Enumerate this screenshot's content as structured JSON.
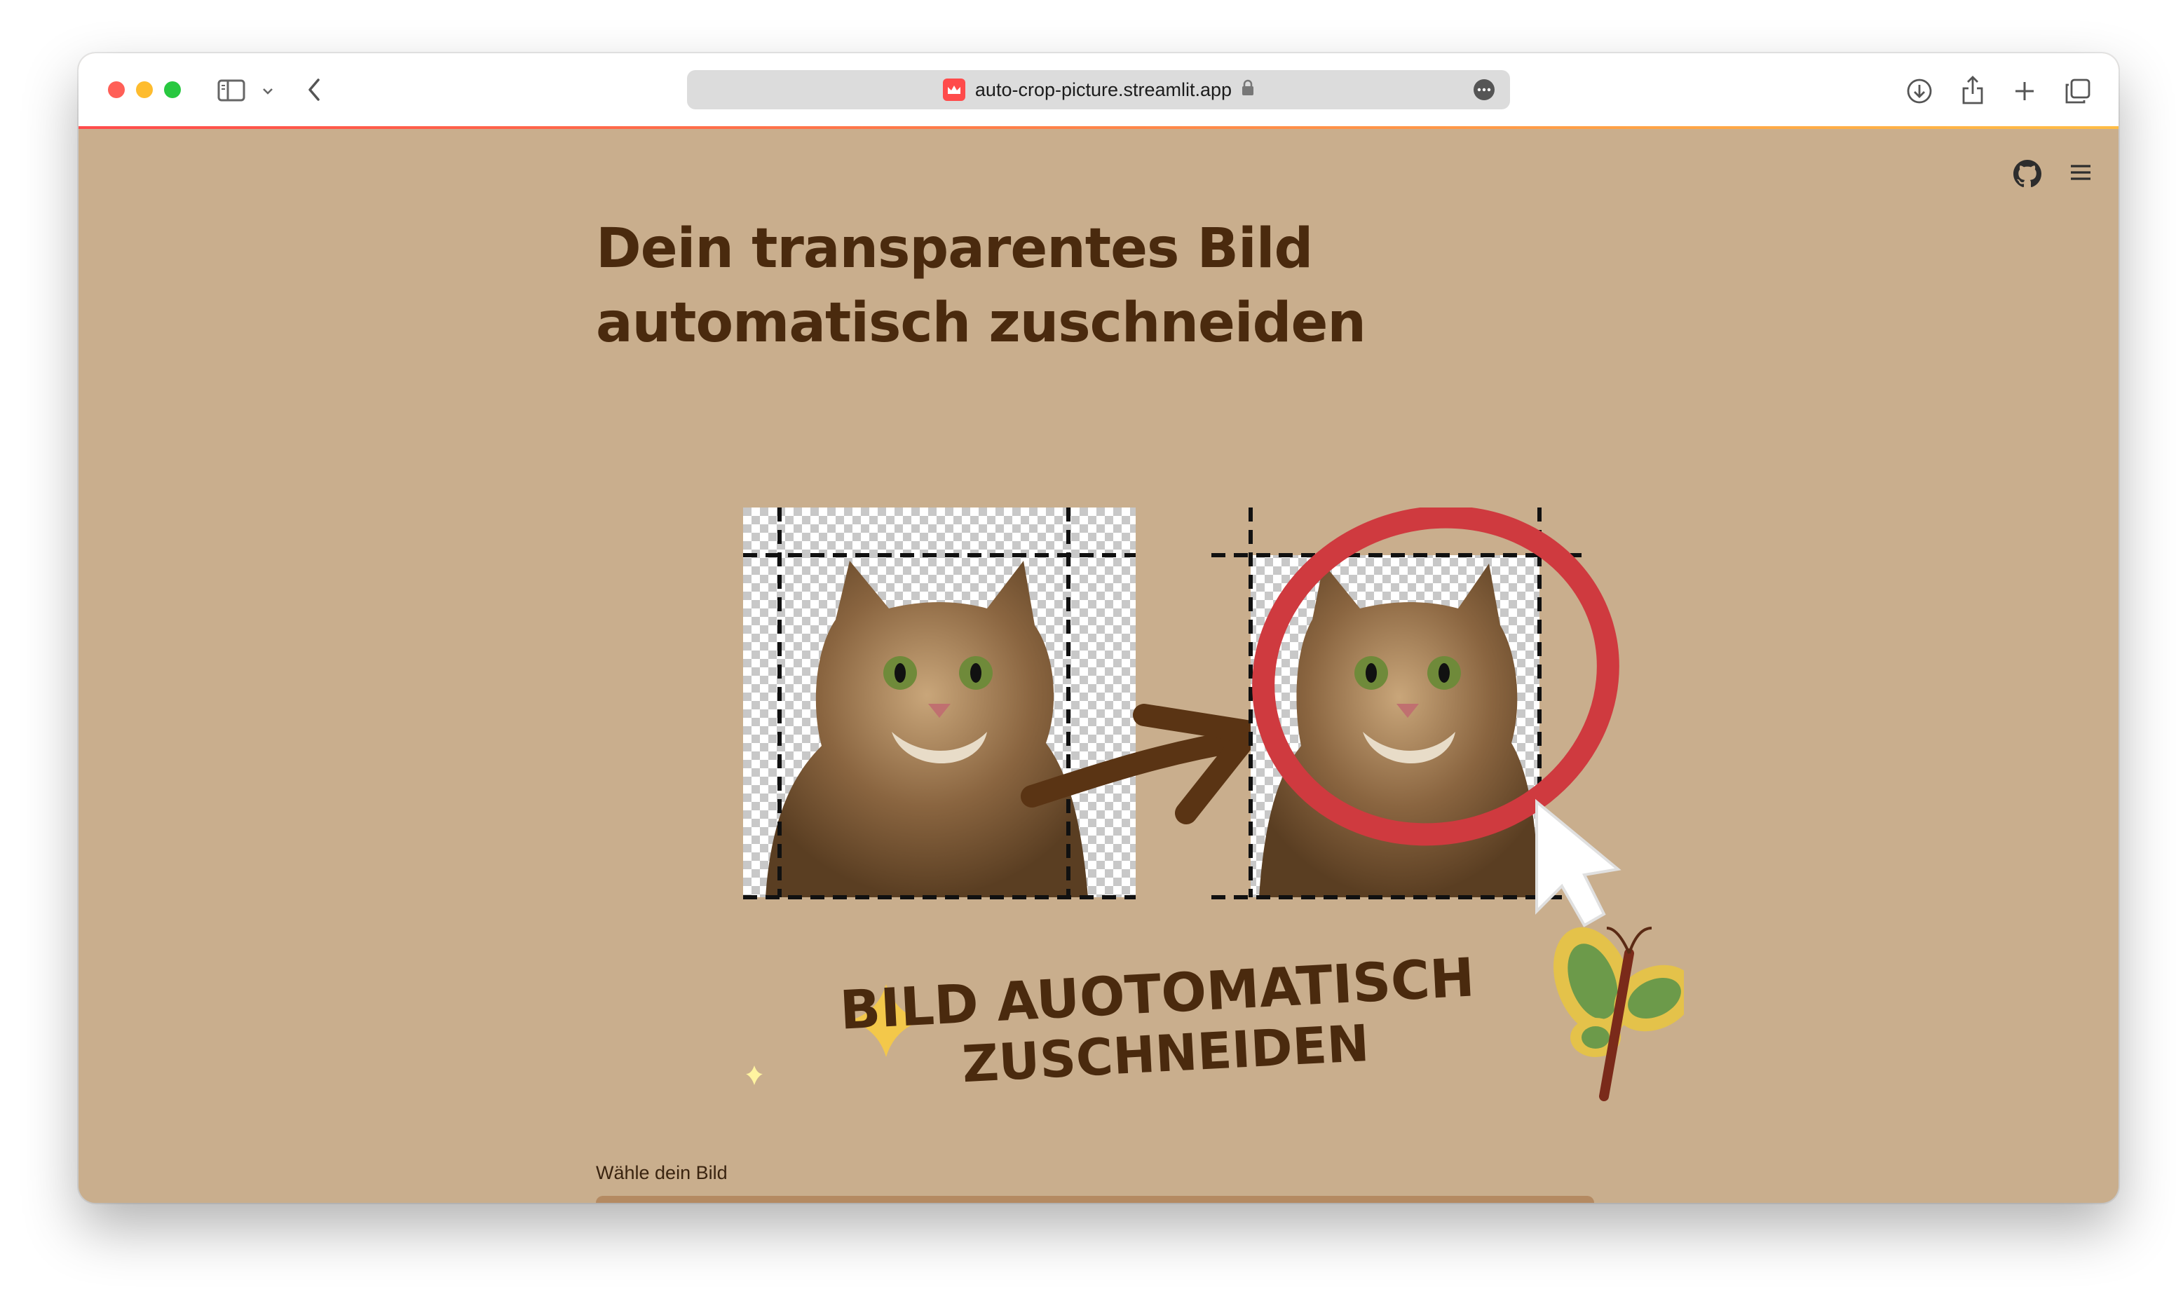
{
  "browser": {
    "url": "auto-crop-picture.streamlit.app"
  },
  "page": {
    "title_line1": "Dein transparentes Bild",
    "title_line2": "automatisch zuschneiden",
    "banner_text_line1": "BILD AUOTOMATISCH",
    "banner_text_line2": "ZUSCHNEIDEN",
    "upload_label": "Wähle dein Bild"
  },
  "icons": {
    "github": "github-icon",
    "menu": "hamburger-menu-icon",
    "streamlit": "streamlit-crown-icon"
  },
  "colors": {
    "background": "#c9ae8d",
    "title": "#4a2a0e",
    "accent": "#ff4b4b",
    "banner_text": "#4a2a0e"
  }
}
